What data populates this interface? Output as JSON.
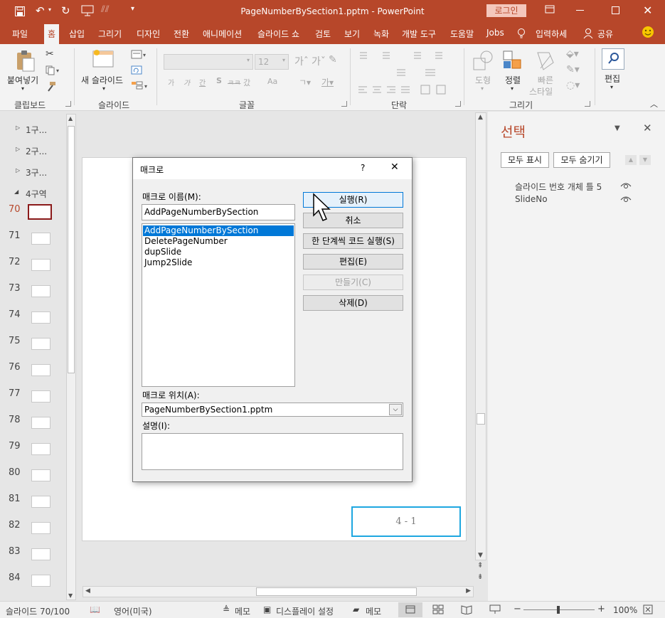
{
  "titlebar": {
    "title": "PageNumberBySection1.pptm  -  PowerPoint",
    "login": "로그인"
  },
  "tabs": [
    "파일",
    "홈",
    "삽입",
    "그리기",
    "디자인",
    "전환",
    "애니메이션",
    "슬라이드 쇼",
    "검토",
    "보기",
    "녹화",
    "개발 도구",
    "도움말",
    "Jobs"
  ],
  "tellme": "입력하세",
  "share": "공유",
  "ribbon": {
    "paste": "붙여넣기",
    "new_slide": "새 슬라이드",
    "font_size": "12",
    "shapes": "도형",
    "arrange": "정렬",
    "quick_styles_1": "빠른",
    "quick_styles_2": "스타일",
    "edit": "편집",
    "groups": {
      "clipboard": "클립보드",
      "slides": "슬라이드",
      "font": "글꼴",
      "paragraph": "단락",
      "drawing": "그리기"
    },
    "font_buttons": [
      "가",
      "가",
      "간",
      "S",
      "ㅋㅋ",
      "갔",
      "Aa"
    ]
  },
  "thumbnails": {
    "sections": [
      "1구...",
      "2구...",
      "3구...",
      "4구역"
    ],
    "slides": [
      "70",
      "71",
      "72",
      "73",
      "74",
      "75",
      "76",
      "77",
      "78",
      "79",
      "80",
      "81",
      "82",
      "83",
      "84"
    ]
  },
  "slide": {
    "page_number": "4 - 1"
  },
  "dialog": {
    "title": "매크로",
    "help": "?",
    "name_label": "매크로 이름(M):",
    "name_value": "AddPageNumberBySection",
    "macros": [
      "AddPageNumberBySection",
      "DeletePageNumber",
      "dupSlide",
      "Jump2Slide"
    ],
    "buttons": {
      "run": "실행(R)",
      "cancel": "취소",
      "step": "한 단계씩 코드 실행(S)",
      "edit": "편집(E)",
      "create": "만들기(C)",
      "delete": "삭제(D)"
    },
    "location_label": "매크로 위치(A):",
    "location_value": "PageNumberBySection1.pptm",
    "description_label": "설명(I):"
  },
  "selection_pane": {
    "title": "선택",
    "show_all": "모두 표시",
    "hide_all": "모두 숨기기",
    "items": [
      "슬라이드 번호 개체 틀 5",
      "SlideNo"
    ]
  },
  "status": {
    "slide_info": "슬라이드 70/100",
    "language": "영어(미국)",
    "notes": "메모",
    "display_settings": "디스플레이 설정",
    "comments": "메모",
    "zoom": "100%"
  },
  "colors": {
    "accent": "#b7472a",
    "highlight": "#1ea7e0",
    "selection": "#0078d7"
  }
}
